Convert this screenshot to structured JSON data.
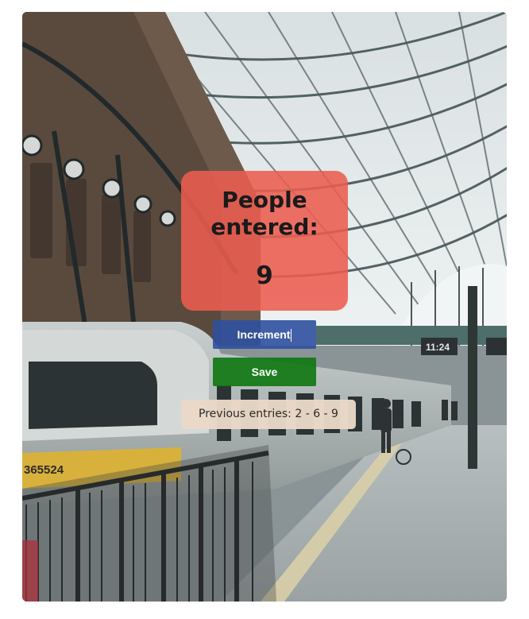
{
  "counter": {
    "title": "People entered:",
    "count": "9"
  },
  "buttons": {
    "increment_label": "Increment",
    "save_label": "Save"
  },
  "previous_entries": "Previous entries: 2 - 6 - 9",
  "background": {
    "platform_clock": "11:24",
    "train_number": "365524"
  },
  "colors": {
    "counter_card": "#EC5C50",
    "increment_button": "#2D50A0",
    "save_button": "#127814",
    "entries_panel": "#EAD8C8"
  }
}
